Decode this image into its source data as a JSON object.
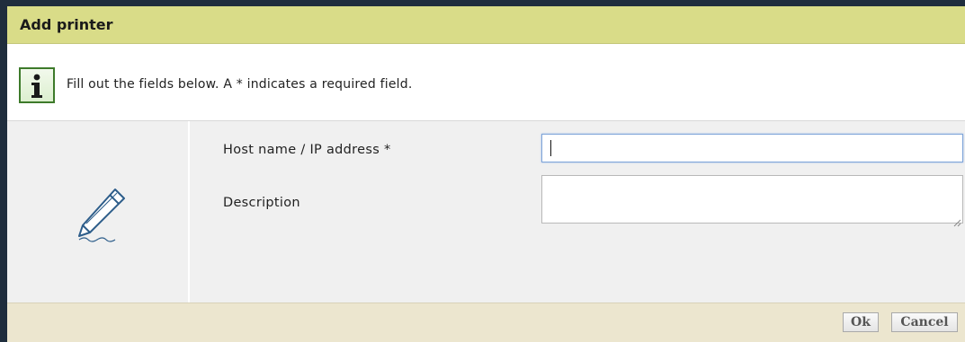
{
  "dialog": {
    "title": "Add printer"
  },
  "info": {
    "icon": "info-icon",
    "text": "Fill out the fields below. A * indicates a required field."
  },
  "form": {
    "side_icon": "pencil-icon",
    "host": {
      "label": "Host name / IP address *",
      "value": ""
    },
    "description": {
      "label": "Description",
      "value": ""
    }
  },
  "buttons": {
    "ok_label": "Ok",
    "cancel_label": "Cancel"
  },
  "colors": {
    "title_bar": "#d9dc88",
    "footer": "#ece6cf",
    "body": "#f0f0f0",
    "frame": "#1f2d3d",
    "info_icon_border": "#3d7a2a"
  }
}
